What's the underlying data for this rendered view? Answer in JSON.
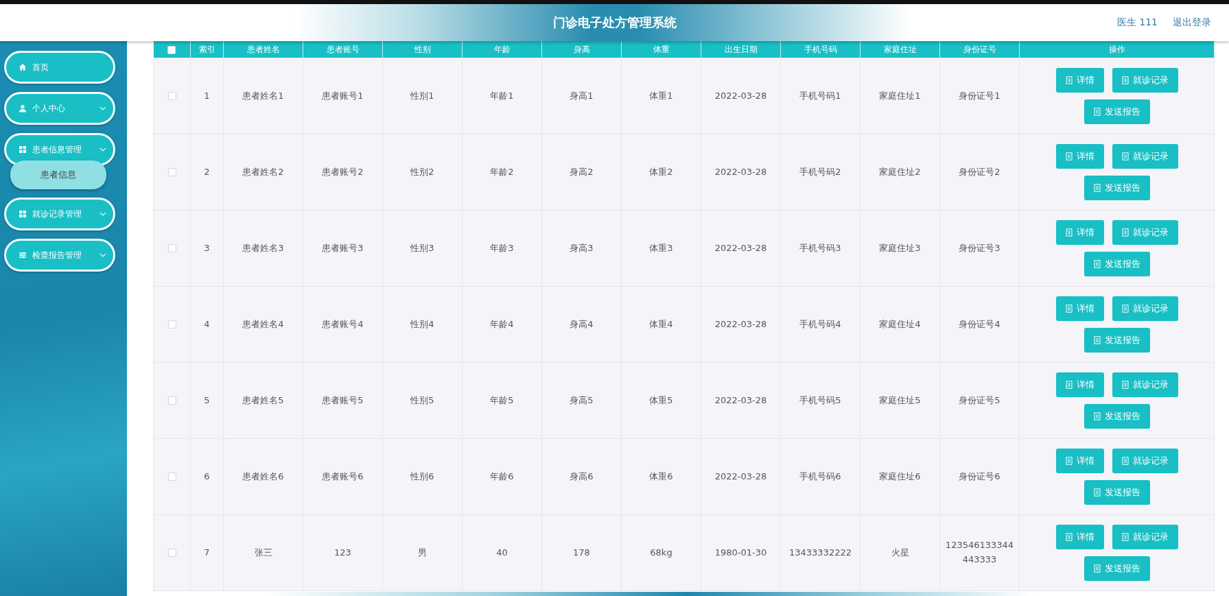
{
  "header": {
    "title": "门诊电子处方管理系统",
    "user": "医生 111",
    "logout": "退出登录"
  },
  "sidebar": {
    "items": [
      {
        "label": "首页",
        "kind": "home",
        "expandable": false
      },
      {
        "label": "个人中心",
        "kind": "user",
        "expandable": true,
        "expanded": false
      },
      {
        "label": "患者信息管理",
        "kind": "grid",
        "expandable": true,
        "expanded": true,
        "children": [
          {
            "label": "患者信息",
            "selected": true
          }
        ]
      },
      {
        "label": "就诊记录管理",
        "kind": "grid",
        "expandable": true,
        "expanded": false
      },
      {
        "label": "检查报告管理",
        "kind": "sliders",
        "expandable": true,
        "expanded": false
      }
    ]
  },
  "table": {
    "select_all": {
      "checked": false
    },
    "columns": [
      "索引",
      "患者姓名",
      "患者账号",
      "性别",
      "年龄",
      "身高",
      "体重",
      "出生日期",
      "手机号码",
      "家庭住址",
      "身份证号",
      "操作"
    ],
    "rows": [
      {
        "checked": false,
        "cells": [
          "1",
          "患者姓名1",
          "患者账号1",
          "性别1",
          "年龄1",
          "身高1",
          "体重1",
          "2022-03-28",
          "手机号码1",
          "家庭住址1",
          "身份证号1"
        ],
        "actions": [
          "详情",
          "就诊记录",
          "发送报告"
        ]
      },
      {
        "checked": false,
        "cells": [
          "2",
          "患者姓名2",
          "患者账号2",
          "性别2",
          "年龄2",
          "身高2",
          "体重2",
          "2022-03-28",
          "手机号码2",
          "家庭住址2",
          "身份证号2"
        ],
        "actions": [
          "详情",
          "就诊记录",
          "发送报告"
        ]
      },
      {
        "checked": false,
        "cells": [
          "3",
          "患者姓名3",
          "患者账号3",
          "性别3",
          "年龄3",
          "身高3",
          "体重3",
          "2022-03-28",
          "手机号码3",
          "家庭住址3",
          "身份证号3"
        ],
        "actions": [
          "详情",
          "就诊记录",
          "发送报告"
        ]
      },
      {
        "checked": false,
        "cells": [
          "4",
          "患者姓名4",
          "患者账号4",
          "性别4",
          "年龄4",
          "身高4",
          "体重4",
          "2022-03-28",
          "手机号码4",
          "家庭住址4",
          "身份证号4"
        ],
        "actions": [
          "详情",
          "就诊记录",
          "发送报告"
        ]
      },
      {
        "checked": false,
        "cells": [
          "5",
          "患者姓名5",
          "患者账号5",
          "性别5",
          "年龄5",
          "身高5",
          "体重5",
          "2022-03-28",
          "手机号码5",
          "家庭住址5",
          "身份证号5"
        ],
        "actions": [
          "详情",
          "就诊记录",
          "发送报告"
        ]
      },
      {
        "checked": false,
        "cells": [
          "6",
          "患者姓名6",
          "患者账号6",
          "性别6",
          "年龄6",
          "身高6",
          "体重6",
          "2022-03-28",
          "手机号码6",
          "家庭住址6",
          "身份证号6"
        ],
        "actions": [
          "详情",
          "就诊记录",
          "发送报告"
        ]
      },
      {
        "checked": false,
        "cells": [
          "7",
          "张三",
          "123",
          "男",
          "40",
          "178",
          "68kg",
          "1980-01-30",
          "13433332222",
          "火星",
          "123546133344443333"
        ],
        "actions": [
          "详情",
          "就诊记录",
          "发送报告"
        ]
      }
    ]
  }
}
